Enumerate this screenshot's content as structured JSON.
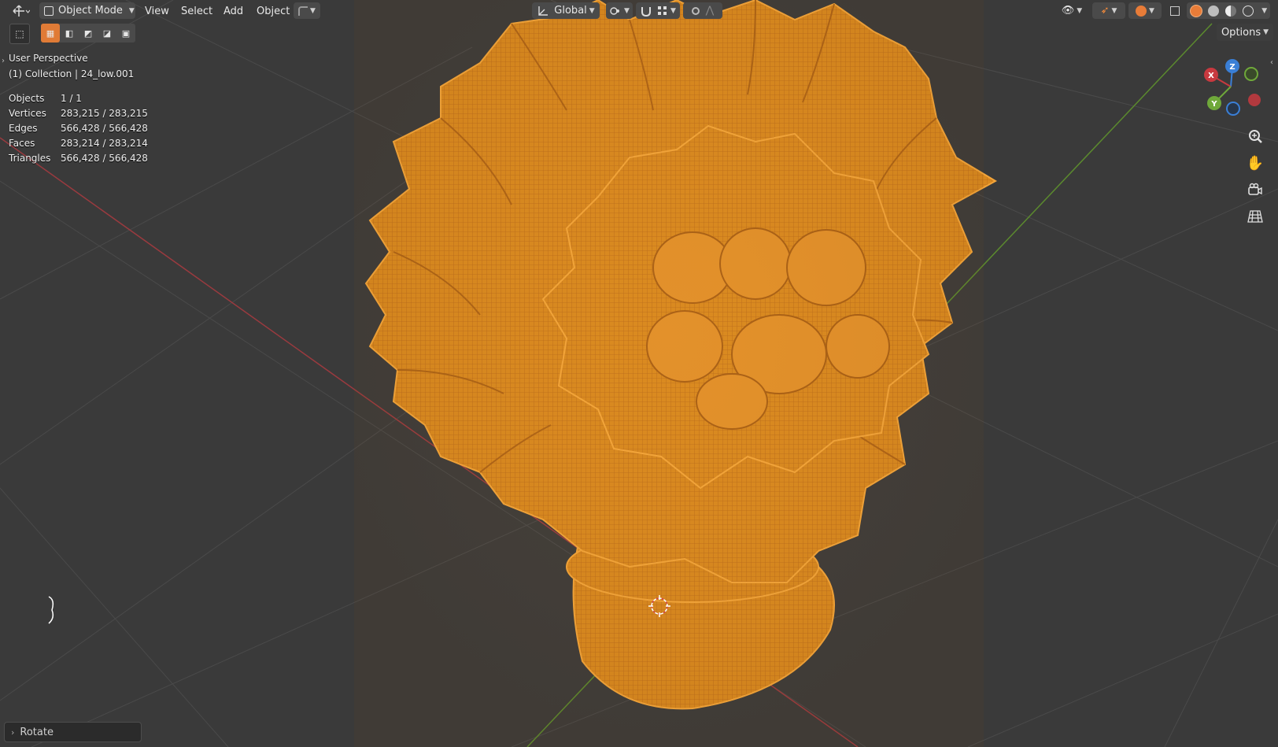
{
  "header": {
    "mode_label": "Object Mode",
    "menus": [
      "View",
      "Select",
      "Add",
      "Object"
    ],
    "transform_orientation": "Global",
    "options_label": "Options"
  },
  "overlay": {
    "view_name": "User Perspective",
    "collection_label": "(1) Collection | 24_low.001",
    "stats": [
      {
        "label": "Objects",
        "value": "1 / 1"
      },
      {
        "label": "Vertices",
        "value": "283,215 / 283,215"
      },
      {
        "label": "Edges",
        "value": "566,428 / 566,428"
      },
      {
        "label": "Faces",
        "value": "283,214 / 283,214"
      },
      {
        "label": "Triangles",
        "value": "566,428 / 566,428"
      }
    ]
  },
  "gizmo": {
    "x": "X",
    "y": "Y",
    "z": "Z"
  },
  "last_operator": "Rotate",
  "colors": {
    "background": "#3a3a3a",
    "mesh_wire": "#f0a033",
    "x_axis": "#c8393f",
    "y_axis": "#6fa83a",
    "z_axis": "#3a7fd6",
    "header_button": "#4a4a4a"
  },
  "icons": {
    "editor_type": "move-arrows-icon",
    "nav_zoom": "zoom-icon",
    "nav_pan": "hand-icon",
    "nav_camera": "camera-icon",
    "nav_ortho": "grid-icon"
  }
}
